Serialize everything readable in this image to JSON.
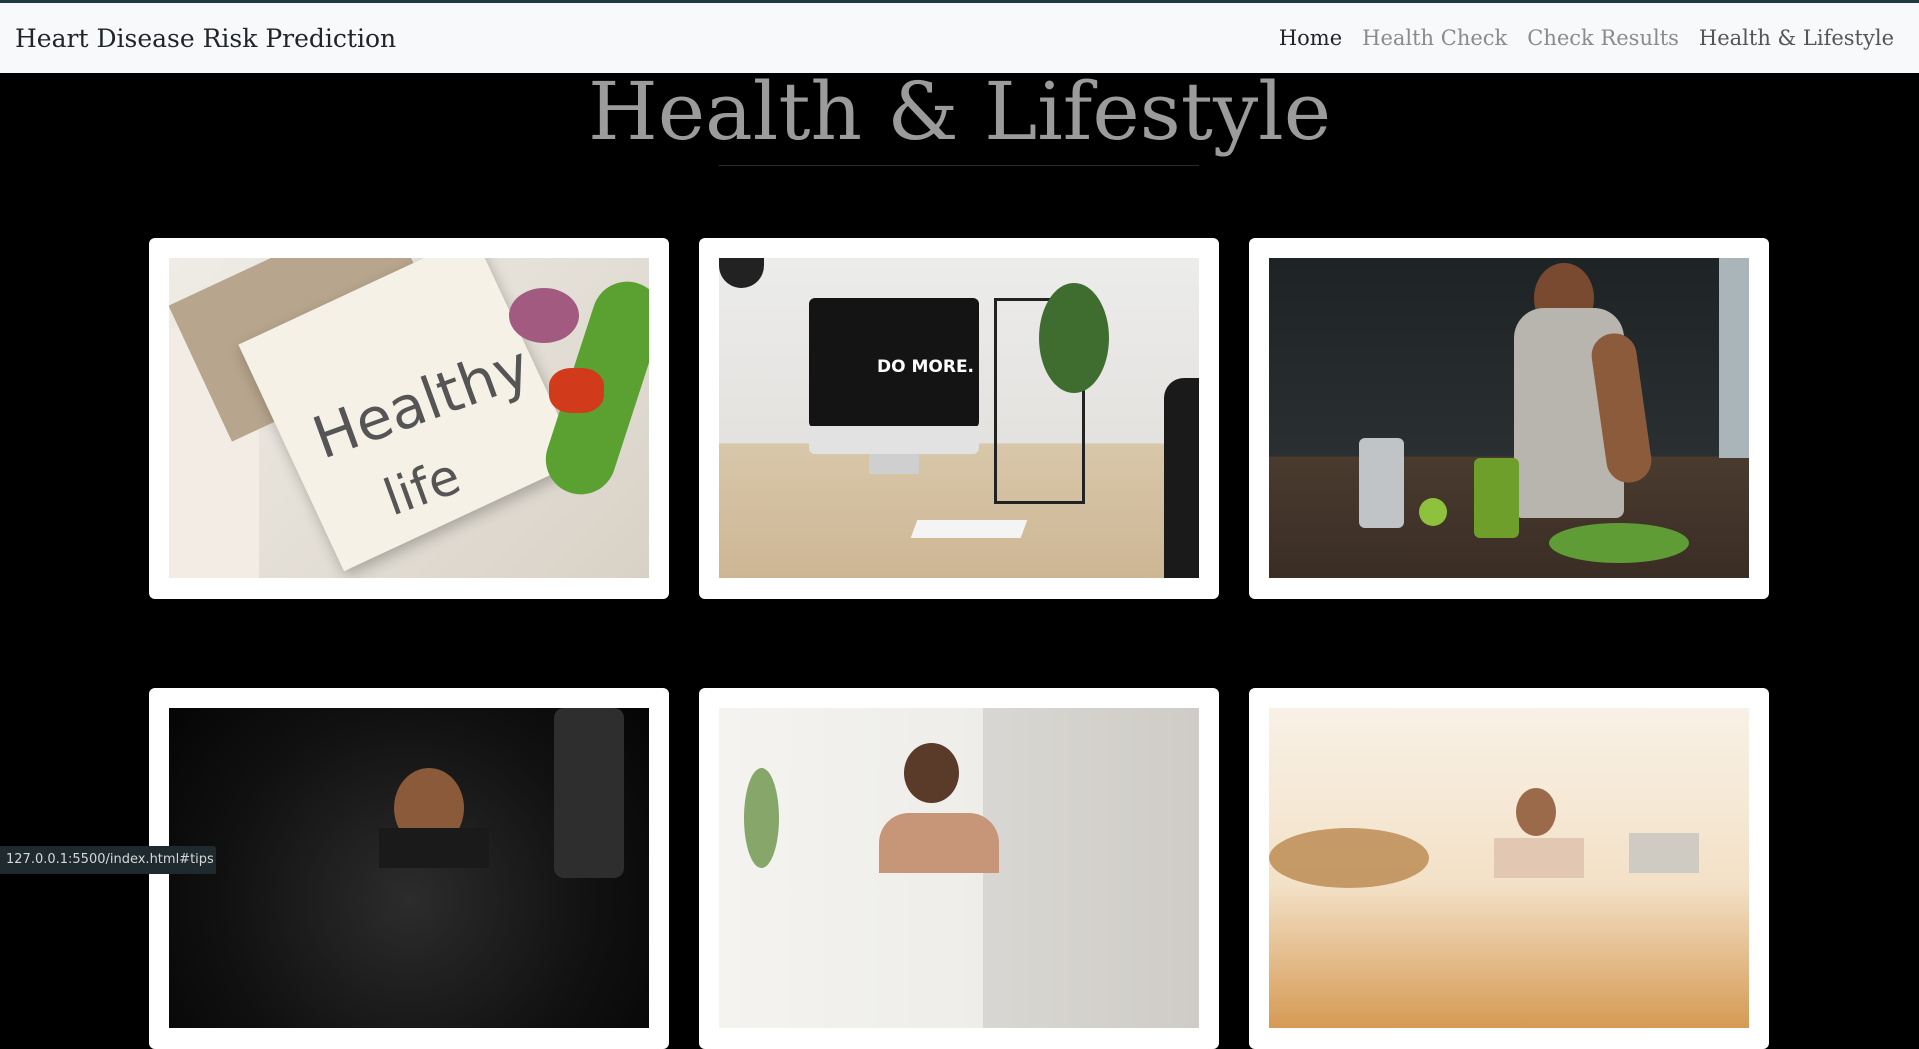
{
  "navbar": {
    "brand": "Heart Disease Risk Prediction",
    "links": [
      {
        "label": "Home"
      },
      {
        "label": "Health Check"
      },
      {
        "label": "Check Results"
      },
      {
        "label": "Health & Lifestyle"
      }
    ]
  },
  "section": {
    "title": "Health & Lifestyle"
  },
  "cards": [
    {
      "photo_text": "Healthy",
      "photo_text2": "life"
    },
    {
      "photo_text": "DO MORE."
    },
    {},
    {},
    {},
    {}
  ],
  "status_bar": {
    "url": "127.0.0.1:5500/index.html#tips"
  }
}
